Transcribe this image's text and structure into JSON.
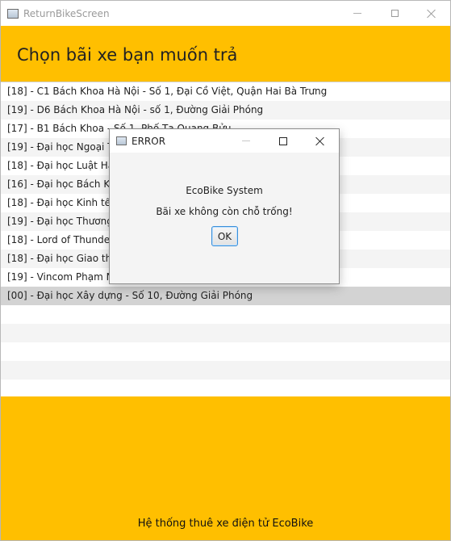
{
  "window": {
    "title": "ReturnBikeScreen"
  },
  "header": {
    "title": "Chọn bãi xe bạn muốn trả"
  },
  "list": {
    "items": [
      "[18] - C1 Bách Khoa Hà Nội - Số 1, Đại Cồ Việt, Quận Hai Bà Trưng",
      "[19] - D6 Bách Khoa Hà Nội - số 1, Đường Giải Phóng",
      "[17] - B1 Bách Khoa - Số 1, Phố Tạ Quang Bửu",
      "[19] - Đại học Ngoại Thư",
      "[18] - Đại học Luật Hà N",
      "[16] - Đại học Bách Khoa",
      "[18] - Đại học Kinh tế qu",
      "[19] - Đại học Thương M",
      "[18] - Lord of Thunder -",
      "[18] - Đại học Giao thôn",
      "[19] - Vincom Phạm Ngọ",
      "[00] - Đại học Xây dựng - Số 10, Đường Giải Phóng"
    ],
    "selected_index": 11
  },
  "footer": {
    "text": "Hệ thống thuê xe điện tử EcoBike"
  },
  "dialog": {
    "title": "ERROR",
    "header": "EcoBike System",
    "message": "Bãi xe không còn chỗ trống!",
    "ok_label": "OK"
  }
}
